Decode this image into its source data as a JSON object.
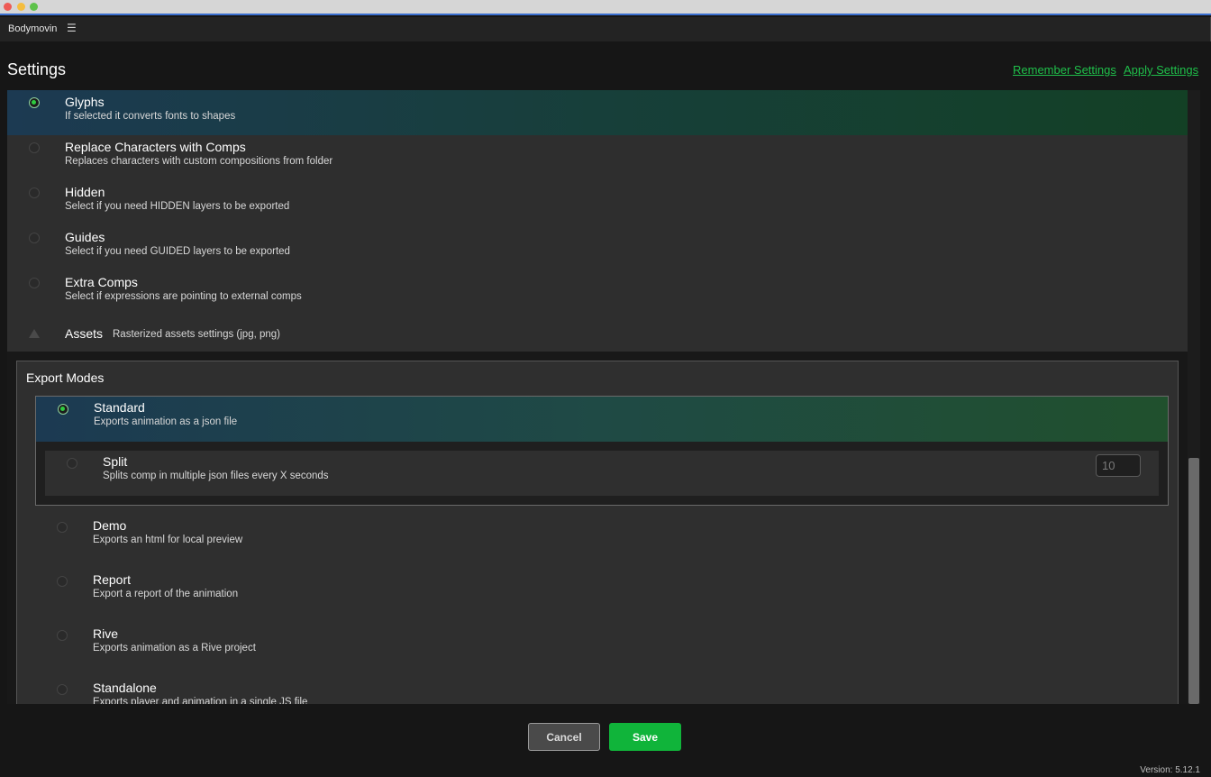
{
  "window": {
    "panel_title": "Bodymovin",
    "menu_icon": "hamburger-icon"
  },
  "header": {
    "title": "Settings",
    "remember_label": "Remember Settings",
    "apply_label": "Apply Settings"
  },
  "options": [
    {
      "title": "Glyphs",
      "desc": "If selected it converts fonts to shapes",
      "selected": true
    },
    {
      "title": "Replace Characters with Comps",
      "desc": "Replaces characters with custom compositions from folder",
      "selected": false
    },
    {
      "title": "Hidden",
      "desc": "Select if you need HIDDEN layers to be exported",
      "selected": false
    },
    {
      "title": "Guides",
      "desc": "Select if you need GUIDED layers to be exported",
      "selected": false
    },
    {
      "title": "Extra Comps",
      "desc": "Select if expressions are pointing to external comps",
      "selected": false
    }
  ],
  "assets": {
    "title": "Assets",
    "desc": "Rasterized assets settings (jpg, png)"
  },
  "export_modes": {
    "heading": "Export Modes",
    "standard": {
      "title": "Standard",
      "desc": "Exports animation as a json file",
      "selected": true
    },
    "split": {
      "title": "Split",
      "desc": "Splits comp in multiple json files every X seconds",
      "selected": false,
      "value": "10"
    },
    "modes": [
      {
        "title": "Demo",
        "desc": "Exports an html for local preview"
      },
      {
        "title": "Report",
        "desc": "Export a report of the animation"
      },
      {
        "title": "Rive",
        "desc": "Exports animation as a Rive project"
      },
      {
        "title": "Standalone",
        "desc": "Exports player and animation in a single JS file"
      }
    ]
  },
  "footer": {
    "cancel_label": "Cancel",
    "save_label": "Save",
    "version": "Version: 5.12.1"
  },
  "colors": {
    "accent_green": "#10b43a",
    "link_green": "#1fbf4a",
    "selected_gradient_start": "#1c3a52",
    "selected_gradient_end": "#134025"
  }
}
